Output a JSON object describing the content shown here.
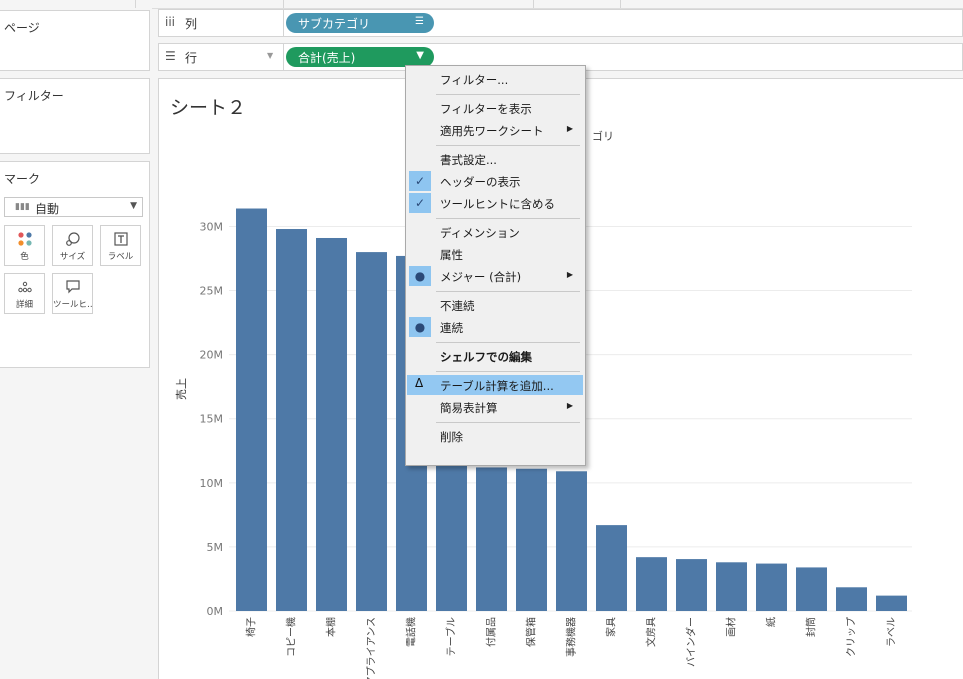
{
  "panels": {
    "pages_title": "ページ",
    "filters_title": "フィルター",
    "marks": {
      "title": "マーク",
      "type_value": "自動",
      "buttons": [
        {
          "label": "色",
          "icon": "color-dots-icon"
        },
        {
          "label": "サイズ",
          "icon": "size-icon"
        },
        {
          "label": "ラベル",
          "icon": "label-icon"
        },
        {
          "label": "詳細",
          "icon": "detail-icon"
        },
        {
          "label": "ツールヒ…",
          "icon": "tooltip-icon"
        }
      ]
    }
  },
  "shelves": {
    "columns": {
      "name": "列",
      "pill": "サブカテゴリ"
    },
    "rows": {
      "name": "行",
      "pill": "合計(売上)"
    }
  },
  "sheet": {
    "title": "シート２",
    "column_caption": "ゴリ"
  },
  "chart_data": {
    "type": "bar",
    "ylabel": "売上",
    "ylim": [
      0,
      33000000
    ],
    "yticks": [
      0,
      5000000,
      10000000,
      15000000,
      20000000,
      25000000,
      30000000
    ],
    "ytick_labels": [
      "0M",
      "5M",
      "10M",
      "15M",
      "20M",
      "25M",
      "30M"
    ],
    "bar_color": "#4e79a7",
    "categories": [
      "椅子",
      "コピー機",
      "本棚",
      "アプライアンス",
      "電話機",
      "テーブル",
      "付属品",
      "保管箱",
      "事務機器",
      "家具",
      "文房具",
      "バインダー",
      "画材",
      "紙",
      "封筒",
      "クリップ",
      "ラベル"
    ],
    "values": [
      31400000,
      29800000,
      29100000,
      28000000,
      27700000,
      26300000,
      11200000,
      11100000,
      10900000,
      6700000,
      4200000,
      4050000,
      3800000,
      3700000,
      3400000,
      1850000,
      1200000
    ]
  },
  "context_menu": {
    "items": [
      {
        "label": "フィルター..."
      },
      {
        "sep": true
      },
      {
        "label": "フィルターを表示"
      },
      {
        "label": "適用先ワークシート",
        "submenu": true
      },
      {
        "sep": true
      },
      {
        "label": "書式設定..."
      },
      {
        "label": "ヘッダーの表示",
        "check": "✓"
      },
      {
        "label": "ツールヒントに含める",
        "check": "✓"
      },
      {
        "sep": true
      },
      {
        "label": "ディメンション"
      },
      {
        "label": "属性"
      },
      {
        "label": "メジャー (合計)",
        "check": "●",
        "submenu": true
      },
      {
        "sep": true
      },
      {
        "label": "不連続"
      },
      {
        "label": "連続",
        "check": "●"
      },
      {
        "sep": true
      },
      {
        "label": "シェルフでの編集",
        "bold": true
      },
      {
        "sep": true
      },
      {
        "label": "テーブル計算を追加...",
        "highlight": true,
        "prefix": "Δ"
      },
      {
        "label": "簡易表計算",
        "submenu": true
      },
      {
        "sep": true
      },
      {
        "label": "削除"
      }
    ]
  }
}
